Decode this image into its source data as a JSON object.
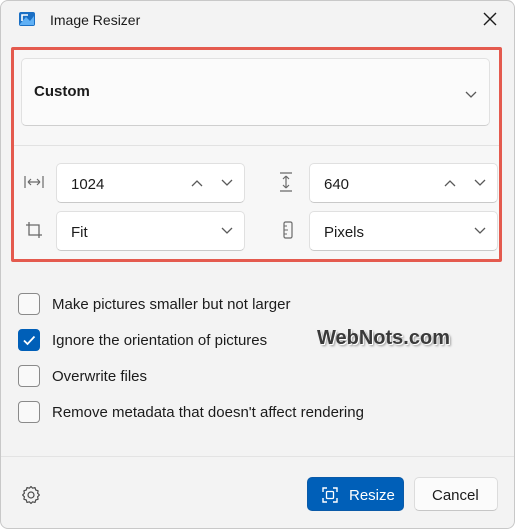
{
  "window": {
    "title": "Image Resizer"
  },
  "preset": {
    "selected": "Custom"
  },
  "size": {
    "width_value": "1024",
    "height_value": "640",
    "fit_value": "Fit",
    "unit_value": "Pixels"
  },
  "options": [
    {
      "label": "Make pictures smaller but not larger",
      "checked": false
    },
    {
      "label": "Ignore the orientation of pictures",
      "checked": true
    },
    {
      "label": "Overwrite files",
      "checked": false
    },
    {
      "label": "Remove metadata that doesn't affect rendering",
      "checked": false
    }
  ],
  "watermark": "WebNots.com",
  "footer": {
    "resize_label": "Resize",
    "cancel_label": "Cancel"
  },
  "colors": {
    "accent": "#005fb8",
    "highlight_border": "#e45a4e"
  }
}
